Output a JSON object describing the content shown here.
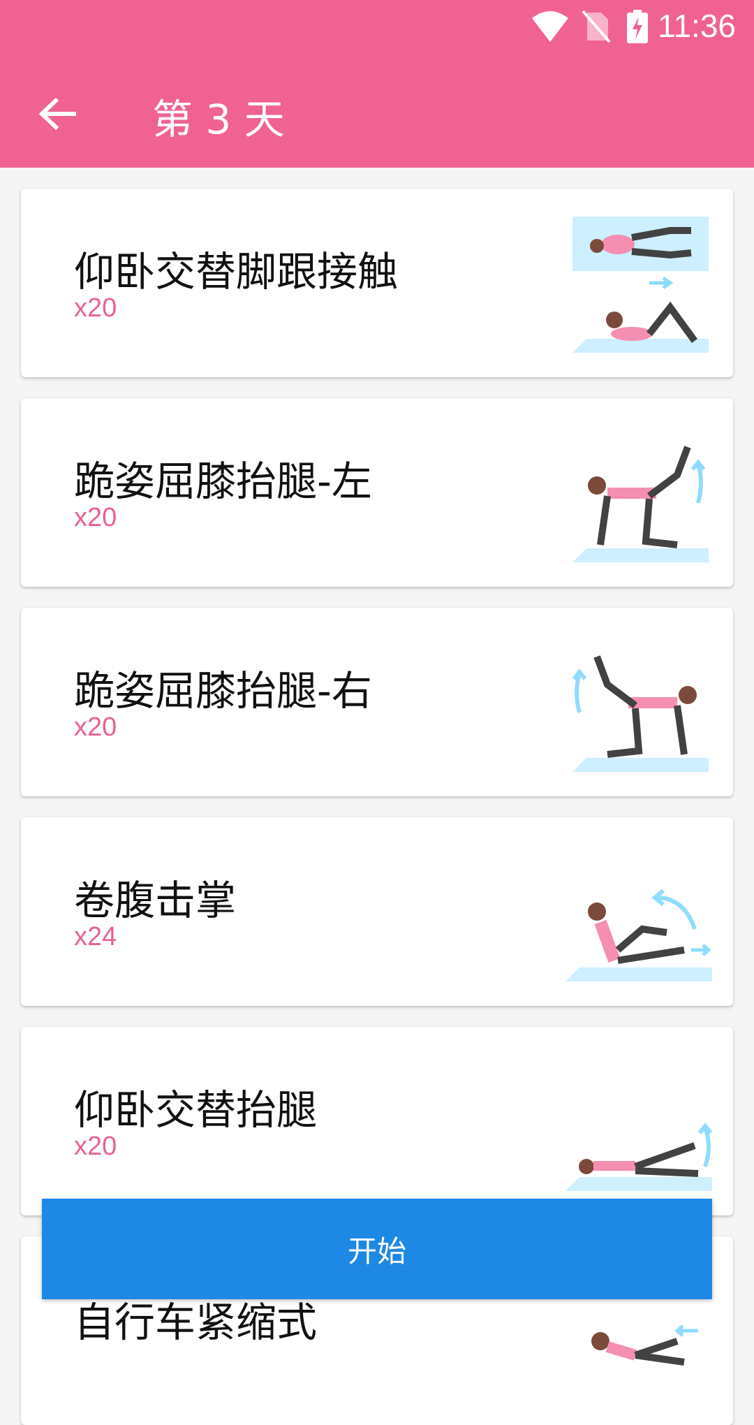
{
  "status_bar": {
    "time": "11:36",
    "icons": [
      "wifi-icon",
      "no-sim-icon",
      "battery-charging-icon"
    ]
  },
  "toolbar": {
    "back_icon": "arrow-left-icon",
    "title": "第 3 天"
  },
  "exercises": [
    {
      "name": "仰卧交替脚跟接触",
      "count": "x20",
      "illustration": "alternate-heel-touch"
    },
    {
      "name": "跪姿屈膝抬腿-左",
      "count": "x20",
      "illustration": "donkey-kick-left"
    },
    {
      "name": "跪姿屈膝抬腿-右",
      "count": "x20",
      "illustration": "donkey-kick-right"
    },
    {
      "name": "卷腹击掌",
      "count": "x24",
      "illustration": "crunch-clap"
    },
    {
      "name": "仰卧交替抬腿",
      "count": "x20",
      "illustration": "alternate-leg-raise"
    },
    {
      "name": "自行车紧缩式",
      "count": "",
      "illustration": "bicycle-crunch"
    }
  ],
  "start_button": {
    "label": "开始"
  },
  "colors": {
    "header": "#f06292",
    "accent_count": "#e7628f",
    "start_button": "#1e88e5",
    "mat": "#cdefff"
  }
}
